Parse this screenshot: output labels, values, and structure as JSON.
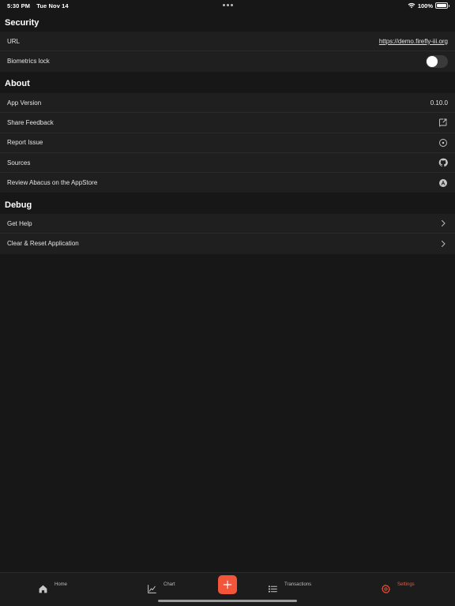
{
  "status_bar": {
    "time": "5:30 PM",
    "date": "Tue Nov 14",
    "battery": "100%",
    "wifi_icon": "wifi-icon",
    "battery_icon": "battery-icon"
  },
  "security": {
    "title": "Security",
    "url_label": "URL",
    "url_value": "https://demo.firefly-iii.org",
    "biometrics_label": "Biometrics lock",
    "biometrics_enabled": false
  },
  "about": {
    "title": "About",
    "app_version_label": "App Version",
    "app_version_value": "0.10.0",
    "share_feedback_label": "Share Feedback",
    "report_issue_label": "Report Issue",
    "sources_label": "Sources",
    "review_label": "Review Abacus on the AppStore"
  },
  "debug": {
    "title": "Debug",
    "get_help_label": "Get Help",
    "clear_reset_label": "Clear & Reset Application"
  },
  "tab_bar": {
    "home": "Home",
    "chart": "Chart",
    "transactions": "Transactions",
    "settings": "Settings",
    "active_tab": "Settings",
    "accent_color": "#f2553a"
  }
}
